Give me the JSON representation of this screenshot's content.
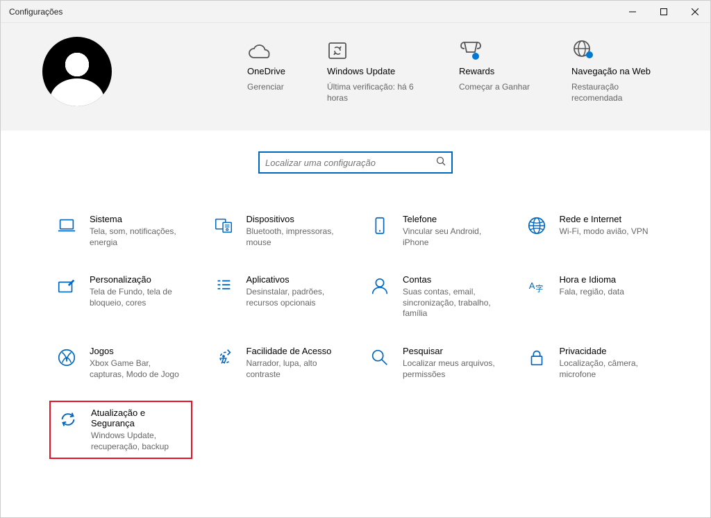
{
  "window": {
    "title": "Configurações"
  },
  "header": {
    "status": [
      {
        "id": "onedrive",
        "title": "OneDrive",
        "sub": "Gerenciar"
      },
      {
        "id": "update",
        "title": "Windows Update",
        "sub": "Última verificação: há 6 horas"
      },
      {
        "id": "rewards",
        "title": "Rewards",
        "sub": "Começar a Ganhar"
      },
      {
        "id": "web",
        "title": "Navegação na Web",
        "sub": "Restauração recomendada"
      }
    ]
  },
  "search": {
    "placeholder": "Localizar uma configuração"
  },
  "categories": [
    {
      "id": "system",
      "title": "Sistema",
      "desc": "Tela, som, notificações, energia"
    },
    {
      "id": "devices",
      "title": "Dispositivos",
      "desc": "Bluetooth, impressoras, mouse"
    },
    {
      "id": "phone",
      "title": "Telefone",
      "desc": "Vincular seu Android, iPhone"
    },
    {
      "id": "network",
      "title": "Rede e Internet",
      "desc": "Wi-Fi, modo avião, VPN"
    },
    {
      "id": "personalization",
      "title": "Personalização",
      "desc": "Tela de Fundo, tela de bloqueio, cores"
    },
    {
      "id": "apps",
      "title": "Aplicativos",
      "desc": "Desinstalar, padrões, recursos opcionais"
    },
    {
      "id": "accounts",
      "title": "Contas",
      "desc": "Suas contas, email, sincronização, trabalho, família"
    },
    {
      "id": "time",
      "title": "Hora e Idioma",
      "desc": "Fala, região, data"
    },
    {
      "id": "gaming",
      "title": "Jogos",
      "desc": "Xbox Game Bar, capturas, Modo de Jogo"
    },
    {
      "id": "ease",
      "title": "Facilidade de Acesso",
      "desc": "Narrador, lupa, alto contraste"
    },
    {
      "id": "search",
      "title": "Pesquisar",
      "desc": "Localizar meus arquivos, permissões"
    },
    {
      "id": "privacy",
      "title": "Privacidade",
      "desc": "Localização, câmera, microfone"
    },
    {
      "id": "update",
      "title": "Atualização e Segurança",
      "desc": "Windows Update, recuperação, backup",
      "highlighted": true
    }
  ]
}
